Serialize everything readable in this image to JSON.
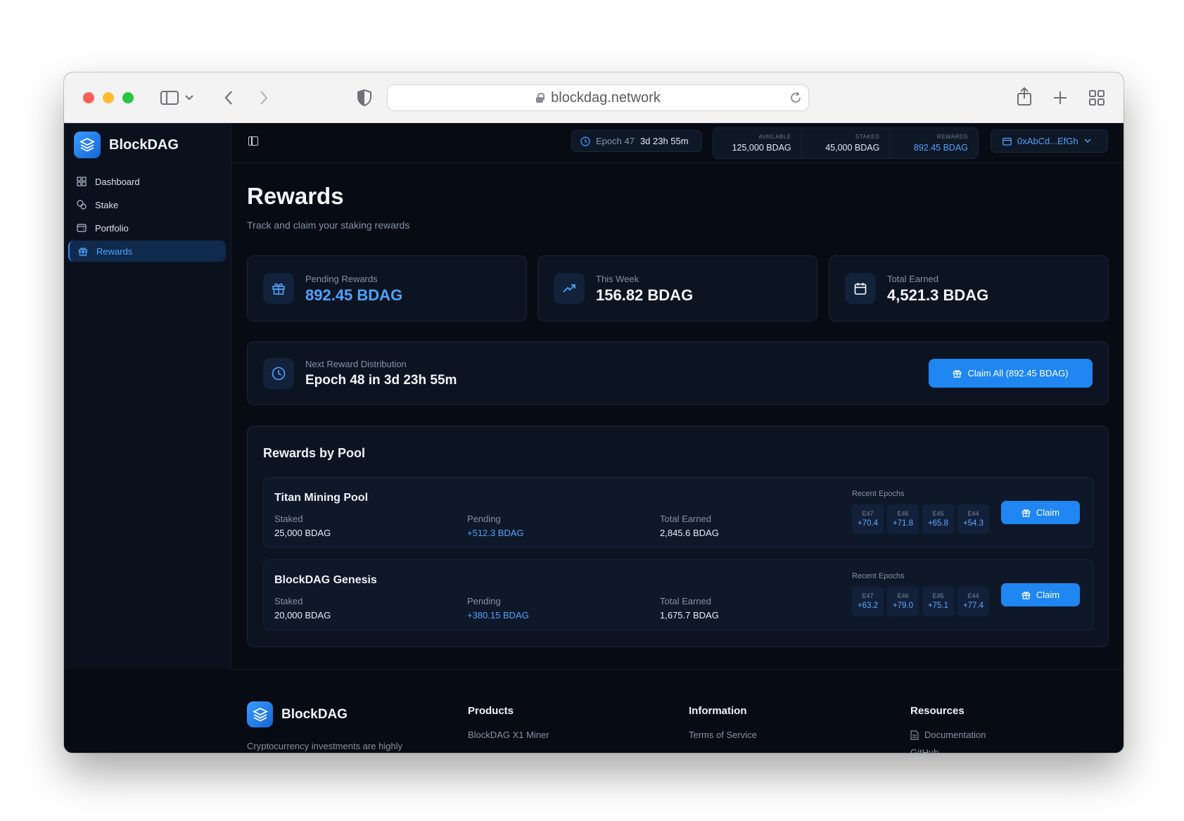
{
  "browser": {
    "url": "blockdag.network"
  },
  "brand": {
    "name": "BlockDAG"
  },
  "sidebar": {
    "items": [
      {
        "label": "Dashboard",
        "icon": "grid-icon",
        "active": false
      },
      {
        "label": "Stake",
        "icon": "coins-icon",
        "active": false
      },
      {
        "label": "Portfolio",
        "icon": "wallet-icon",
        "active": false
      },
      {
        "label": "Rewards",
        "icon": "gift-icon",
        "active": true
      }
    ]
  },
  "topbar": {
    "epoch_label": "Epoch 47",
    "epoch_time": "3d 23h 55m",
    "available_label": "AVAILABLE",
    "available_value": "125,000 BDAG",
    "staked_label": "STAKED",
    "staked_value": "45,000 BDAG",
    "rewards_label": "REWARDS",
    "rewards_value": "892.45 BDAG",
    "wallet": "0xAbCd...EfGh"
  },
  "page": {
    "title": "Rewards",
    "subtitle": "Track and claim your staking rewards"
  },
  "stat_cards": [
    {
      "label": "Pending Rewards",
      "value": "892.45 BDAG",
      "icon": "gift-icon"
    },
    {
      "label": "This Week",
      "value": "156.82 BDAG",
      "icon": "trending-up-icon"
    },
    {
      "label": "Total Earned",
      "value": "4,521.3 BDAG",
      "icon": "calendar-icon"
    }
  ],
  "next_distribution": {
    "label": "Next Reward Distribution",
    "value": "Epoch 48 in 3d 23h 55m",
    "claim_all": "Claim All (892.45 BDAG)"
  },
  "pools": {
    "title": "Rewards by Pool",
    "staked_label": "Staked",
    "pending_label": "Pending",
    "total_label": "Total Earned",
    "recent_label": "Recent Epochs",
    "claim_label": "Claim",
    "rows": [
      {
        "name": "Titan Mining Pool",
        "staked": "25,000 BDAG",
        "pending": "+512.3 BDAG",
        "total": "2,845.6 BDAG",
        "epochs": [
          {
            "e": "E47",
            "n": "+70.4"
          },
          {
            "e": "E46",
            "n": "+71.8"
          },
          {
            "e": "E45",
            "n": "+65.8"
          },
          {
            "e": "E44",
            "n": "+54.3"
          }
        ]
      },
      {
        "name": "BlockDAG Genesis",
        "staked": "20,000 BDAG",
        "pending": "+380.15 BDAG",
        "total": "1,675.7 BDAG",
        "epochs": [
          {
            "e": "E47",
            "n": "+63.2"
          },
          {
            "e": "E46",
            "n": "+79.0"
          },
          {
            "e": "E45",
            "n": "+75.1"
          },
          {
            "e": "E44",
            "n": "+77.4"
          }
        ]
      }
    ]
  },
  "footer": {
    "description": "Cryptocurrency investments are highly",
    "products_title": "Products",
    "products_item": "BlockDAG X1 Miner",
    "information_title": "Information",
    "information_item": "Terms of Service",
    "resources_title": "Resources",
    "resources_item": "Documentation",
    "resources_item2": "GitHub"
  },
  "colors": {
    "accent": "#1f86f2",
    "accent_text": "#4ea3ff",
    "background": "#070b14"
  }
}
